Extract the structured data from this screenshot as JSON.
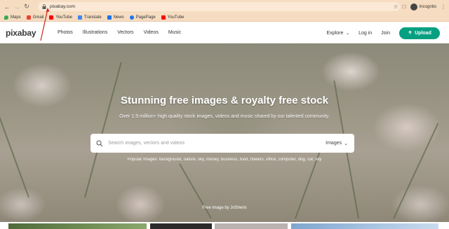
{
  "browser": {
    "url": "pixabay.com",
    "profile": "Incognito",
    "bookmarks": [
      {
        "label": "Maps",
        "color": "#34a853"
      },
      {
        "label": "Gmail",
        "color": "#ea4335"
      },
      {
        "label": "YouTube",
        "color": "#ff0000"
      },
      {
        "label": "Translate",
        "color": "#4285f4"
      },
      {
        "label": "News",
        "color": "#1a73e8"
      },
      {
        "label": "PagePage",
        "color": "#1877f2"
      },
      {
        "label": "YouTube",
        "color": "#ff0000"
      }
    ]
  },
  "header": {
    "logo": "pixabay",
    "nav": [
      "Photos",
      "Illustrations",
      "Vectors",
      "Videos",
      "Music"
    ],
    "explore": "Explore",
    "login": "Log in",
    "join": "Join",
    "upload": "Upload",
    "accent": "#05a081"
  },
  "hero": {
    "title": "Stunning free images & royalty free stock",
    "subtitle": "Over 1.9 million+ high quality stock images, videos and music shared by our talented community.",
    "search_placeholder": "Search images, vectors and videos",
    "search_type": "Images",
    "popular": "Popular Images: background, nature, sky, money, business, food, flowers, office, computer, dog, cat, sky",
    "credit": "Free image by JoSheris"
  }
}
